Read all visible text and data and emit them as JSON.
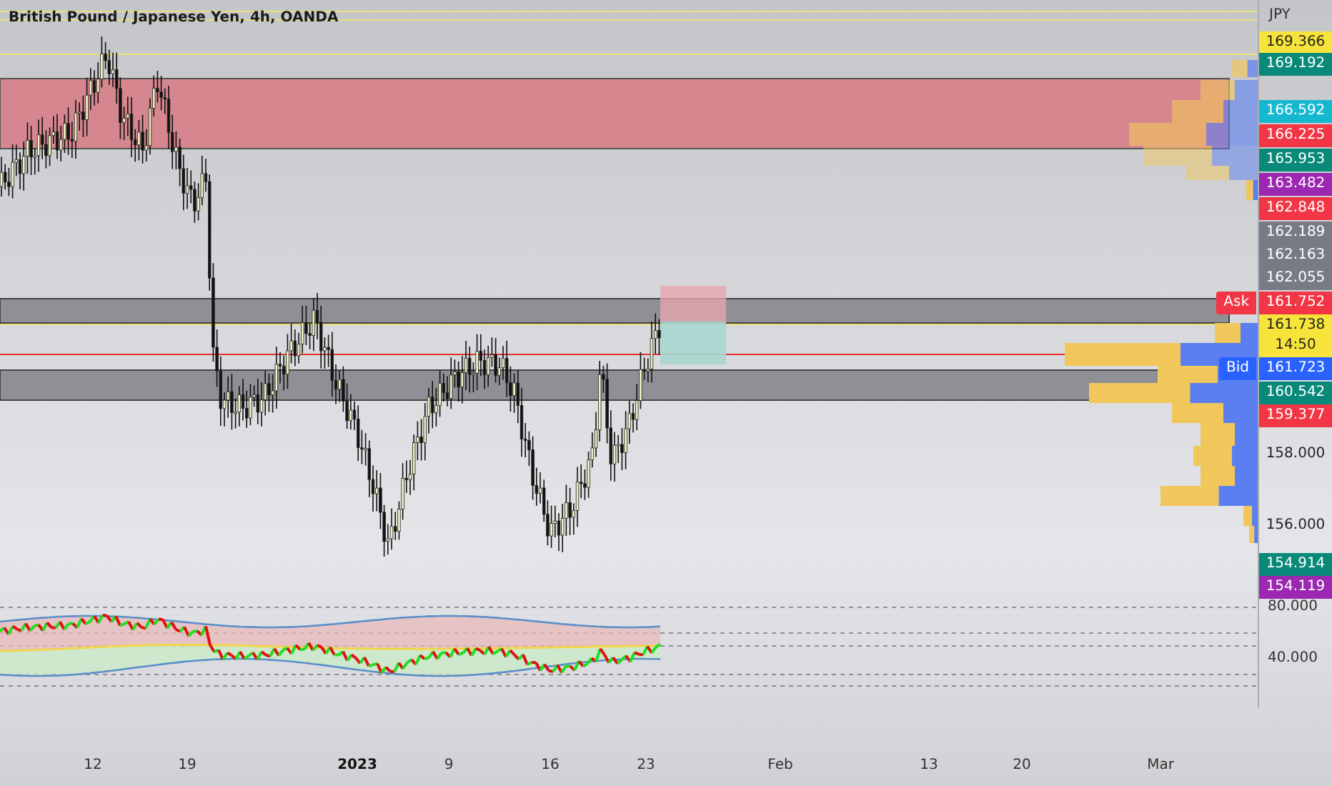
{
  "title": "British Pound / Japanese Yen, 4h, OANDA",
  "price_scale": {
    "currency": "JPY",
    "labels": [
      {
        "kind": "badge",
        "text": "169.366",
        "color": "#f7e43a"
      },
      {
        "kind": "badge",
        "text": "169.192",
        "color": "#08897a"
      },
      {
        "kind": "badge",
        "text": "166.592",
        "color": "#16b8d0"
      },
      {
        "kind": "badge",
        "text": "166.225",
        "color": "#f23645"
      },
      {
        "kind": "badge",
        "text": "165.953",
        "color": "#08897a"
      },
      {
        "kind": "badge",
        "text": "163.482",
        "color": "#9c27b0"
      },
      {
        "kind": "badge",
        "text": "162.848",
        "color": "#f23645"
      },
      {
        "kind": "badge",
        "text": "162.189",
        "color": "#787b86"
      },
      {
        "kind": "badge",
        "text": "162.163",
        "color": "#787b86"
      },
      {
        "kind": "badge",
        "text": "162.055",
        "color": "#787b86"
      },
      {
        "kind": "badge",
        "text": "161.752",
        "color": "#f23645",
        "tag": "Ask"
      },
      {
        "kind": "badge",
        "text": "161.738",
        "sub": "14:50",
        "color": "#f7e43a"
      },
      {
        "kind": "badge",
        "text": "161.723",
        "color": "#2962ff",
        "tag": "Bid"
      },
      {
        "kind": "badge",
        "text": "160.542",
        "color": "#08897a"
      },
      {
        "kind": "badge",
        "text": "159.377",
        "color": "#f23645"
      },
      {
        "kind": "tick",
        "text": "158.000"
      },
      {
        "kind": "tick",
        "text": "156.000"
      },
      {
        "kind": "badge",
        "text": "154.914",
        "color": "#08897a"
      },
      {
        "kind": "badge",
        "text": "154.119",
        "color": "#9c27b0"
      }
    ]
  },
  "indicator_scale": {
    "labels": [
      "80.000",
      "40.000"
    ]
  },
  "time_axis": [
    {
      "text": "12",
      "bold": false
    },
    {
      "text": "19",
      "bold": false
    },
    {
      "text": "2023",
      "bold": true
    },
    {
      "text": "9",
      "bold": false
    },
    {
      "text": "16",
      "bold": false
    },
    {
      "text": "23",
      "bold": false
    },
    {
      "text": "Feb",
      "bold": false
    },
    {
      "text": "13",
      "bold": false
    },
    {
      "text": "20",
      "bold": false
    },
    {
      "text": "Mar",
      "bold": false
    }
  ]
}
